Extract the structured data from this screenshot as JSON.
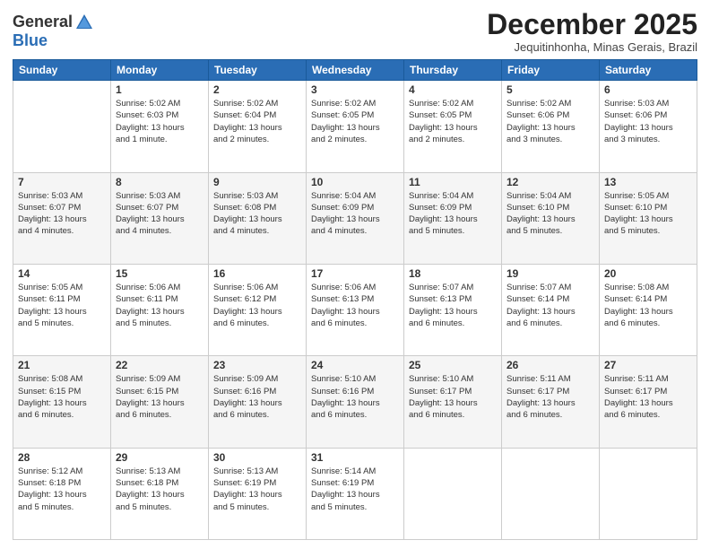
{
  "logo": {
    "general": "General",
    "blue": "Blue"
  },
  "header": {
    "month": "December 2025",
    "location": "Jequitinhonha, Minas Gerais, Brazil"
  },
  "days": [
    "Sunday",
    "Monday",
    "Tuesday",
    "Wednesday",
    "Thursday",
    "Friday",
    "Saturday"
  ],
  "weeks": [
    [
      {
        "day": "",
        "info": ""
      },
      {
        "day": "1",
        "info": "Sunrise: 5:02 AM\nSunset: 6:03 PM\nDaylight: 13 hours\nand 1 minute."
      },
      {
        "day": "2",
        "info": "Sunrise: 5:02 AM\nSunset: 6:04 PM\nDaylight: 13 hours\nand 2 minutes."
      },
      {
        "day": "3",
        "info": "Sunrise: 5:02 AM\nSunset: 6:05 PM\nDaylight: 13 hours\nand 2 minutes."
      },
      {
        "day": "4",
        "info": "Sunrise: 5:02 AM\nSunset: 6:05 PM\nDaylight: 13 hours\nand 2 minutes."
      },
      {
        "day": "5",
        "info": "Sunrise: 5:02 AM\nSunset: 6:06 PM\nDaylight: 13 hours\nand 3 minutes."
      },
      {
        "day": "6",
        "info": "Sunrise: 5:03 AM\nSunset: 6:06 PM\nDaylight: 13 hours\nand 3 minutes."
      }
    ],
    [
      {
        "day": "7",
        "info": "Sunrise: 5:03 AM\nSunset: 6:07 PM\nDaylight: 13 hours\nand 4 minutes."
      },
      {
        "day": "8",
        "info": "Sunrise: 5:03 AM\nSunset: 6:07 PM\nDaylight: 13 hours\nand 4 minutes."
      },
      {
        "day": "9",
        "info": "Sunrise: 5:03 AM\nSunset: 6:08 PM\nDaylight: 13 hours\nand 4 minutes."
      },
      {
        "day": "10",
        "info": "Sunrise: 5:04 AM\nSunset: 6:09 PM\nDaylight: 13 hours\nand 4 minutes."
      },
      {
        "day": "11",
        "info": "Sunrise: 5:04 AM\nSunset: 6:09 PM\nDaylight: 13 hours\nand 5 minutes."
      },
      {
        "day": "12",
        "info": "Sunrise: 5:04 AM\nSunset: 6:10 PM\nDaylight: 13 hours\nand 5 minutes."
      },
      {
        "day": "13",
        "info": "Sunrise: 5:05 AM\nSunset: 6:10 PM\nDaylight: 13 hours\nand 5 minutes."
      }
    ],
    [
      {
        "day": "14",
        "info": "Sunrise: 5:05 AM\nSunset: 6:11 PM\nDaylight: 13 hours\nand 5 minutes."
      },
      {
        "day": "15",
        "info": "Sunrise: 5:06 AM\nSunset: 6:11 PM\nDaylight: 13 hours\nand 5 minutes."
      },
      {
        "day": "16",
        "info": "Sunrise: 5:06 AM\nSunset: 6:12 PM\nDaylight: 13 hours\nand 6 minutes."
      },
      {
        "day": "17",
        "info": "Sunrise: 5:06 AM\nSunset: 6:13 PM\nDaylight: 13 hours\nand 6 minutes."
      },
      {
        "day": "18",
        "info": "Sunrise: 5:07 AM\nSunset: 6:13 PM\nDaylight: 13 hours\nand 6 minutes."
      },
      {
        "day": "19",
        "info": "Sunrise: 5:07 AM\nSunset: 6:14 PM\nDaylight: 13 hours\nand 6 minutes."
      },
      {
        "day": "20",
        "info": "Sunrise: 5:08 AM\nSunset: 6:14 PM\nDaylight: 13 hours\nand 6 minutes."
      }
    ],
    [
      {
        "day": "21",
        "info": "Sunrise: 5:08 AM\nSunset: 6:15 PM\nDaylight: 13 hours\nand 6 minutes."
      },
      {
        "day": "22",
        "info": "Sunrise: 5:09 AM\nSunset: 6:15 PM\nDaylight: 13 hours\nand 6 minutes."
      },
      {
        "day": "23",
        "info": "Sunrise: 5:09 AM\nSunset: 6:16 PM\nDaylight: 13 hours\nand 6 minutes."
      },
      {
        "day": "24",
        "info": "Sunrise: 5:10 AM\nSunset: 6:16 PM\nDaylight: 13 hours\nand 6 minutes."
      },
      {
        "day": "25",
        "info": "Sunrise: 5:10 AM\nSunset: 6:17 PM\nDaylight: 13 hours\nand 6 minutes."
      },
      {
        "day": "26",
        "info": "Sunrise: 5:11 AM\nSunset: 6:17 PM\nDaylight: 13 hours\nand 6 minutes."
      },
      {
        "day": "27",
        "info": "Sunrise: 5:11 AM\nSunset: 6:17 PM\nDaylight: 13 hours\nand 6 minutes."
      }
    ],
    [
      {
        "day": "28",
        "info": "Sunrise: 5:12 AM\nSunset: 6:18 PM\nDaylight: 13 hours\nand 5 minutes."
      },
      {
        "day": "29",
        "info": "Sunrise: 5:13 AM\nSunset: 6:18 PM\nDaylight: 13 hours\nand 5 minutes."
      },
      {
        "day": "30",
        "info": "Sunrise: 5:13 AM\nSunset: 6:19 PM\nDaylight: 13 hours\nand 5 minutes."
      },
      {
        "day": "31",
        "info": "Sunrise: 5:14 AM\nSunset: 6:19 PM\nDaylight: 13 hours\nand 5 minutes."
      },
      {
        "day": "",
        "info": ""
      },
      {
        "day": "",
        "info": ""
      },
      {
        "day": "",
        "info": ""
      }
    ]
  ]
}
